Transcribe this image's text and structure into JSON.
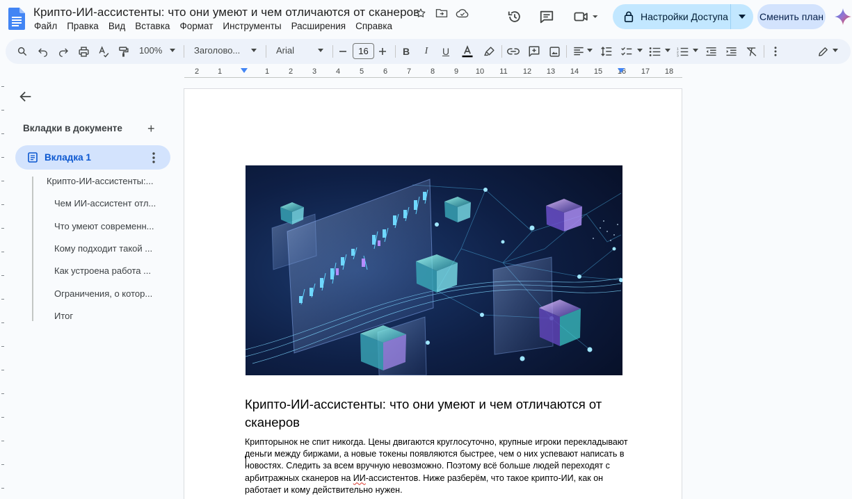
{
  "doc": {
    "title": "Крипто-ИИ-ассистенты: что они умеют и чем отличаются от сканеров"
  },
  "menu": [
    "Файл",
    "Правка",
    "Вид",
    "Вставка",
    "Формат",
    "Инструменты",
    "Расширения",
    "Справка"
  ],
  "header": {
    "share_label": "Настройки Доступа",
    "plan_label": "Сменить план"
  },
  "toolbar": {
    "zoom": "100%",
    "style": "Заголово...",
    "font": "Arial",
    "font_size": "16"
  },
  "ruler": {
    "numbers": [
      "2",
      "1",
      "1",
      "2",
      "3",
      "4",
      "5",
      "6",
      "7",
      "8",
      "9",
      "10",
      "11",
      "12",
      "13",
      "14",
      "15",
      "16",
      "17",
      "18"
    ]
  },
  "sidebar": {
    "title": "Вкладки в документе",
    "active_tab": "Вкладка 1",
    "outline": [
      "Крипто-ИИ-ассистенты:...",
      "Чем ИИ-ассистент отл...",
      "Что умеют современн...",
      "Кому подходит такой ...",
      "Как устроена работа ...",
      "Ограничения, о котор...",
      "Итог"
    ]
  },
  "body": {
    "heading": "Крипто-ИИ-ассистенты: что они умеют и чем отличаются от сканеров",
    "para_before": "Крипторынок не спит никогда. Цены двигаются круглосуточно, крупные игроки перекладывают деньги между биржами, а новые токены появляются быстрее, чем о них успевают написать в новостях. Следить за всем вручную невозможно. Поэтому всё больше людей переходят с арбитражных сканеров на ",
    "para_misspelled": "ИИ",
    "para_after": "-ассистентов. Ниже разберём, что такое крипто-ИИ, как он работает и кому действительно нужен."
  },
  "colors": {
    "accent": "#0b57d0",
    "share_bg": "#c2e7ff",
    "plan_bg": "#d3e3fd",
    "toolbar_bg": "#edf2fa"
  }
}
